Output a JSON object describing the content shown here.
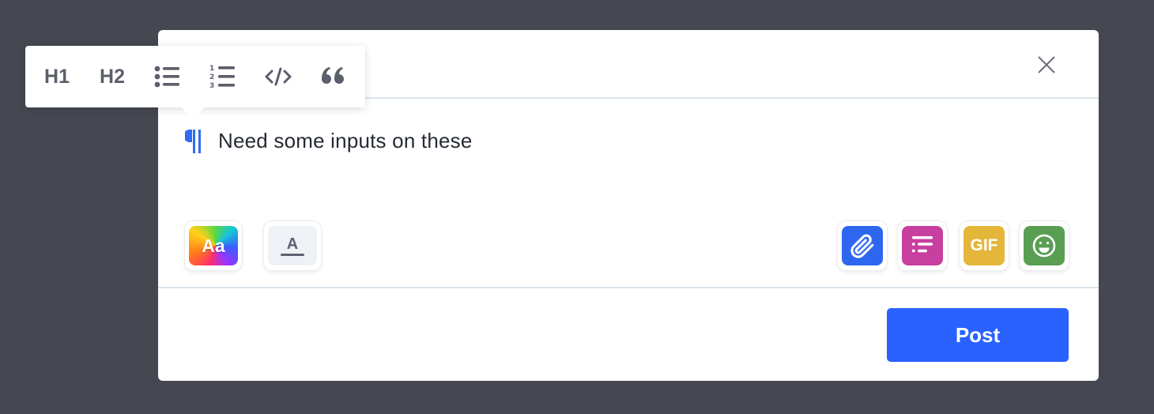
{
  "format_toolbar": {
    "h1_label": "H1",
    "h2_label": "H2",
    "icons": [
      "bullet-list-icon",
      "numbered-list-icon",
      "code-icon",
      "quote-icon"
    ],
    "icon_color": "#5b5f6b"
  },
  "editor": {
    "text": "Need some inputs on these",
    "paragraph_marker_color": "#2f6bf5"
  },
  "tools": {
    "text_style_label": "Aa",
    "text_format_label": "A",
    "gif_label": "GIF",
    "colors": {
      "attachment": "#2e66f0",
      "poll": "#c73f9f",
      "gif": "#e4b63a",
      "emoji": "#5a9e53"
    }
  },
  "footer": {
    "post_label": "Post",
    "post_color": "#2962ff"
  }
}
